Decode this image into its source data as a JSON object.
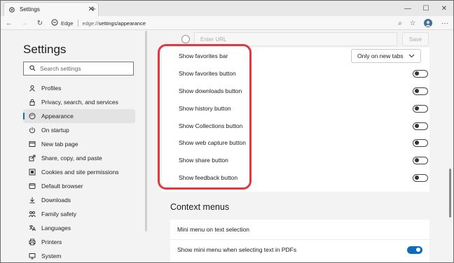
{
  "browser": {
    "tab_title": "Settings",
    "new_tab_symbol": "+",
    "site_label": "Edge",
    "url_prefix": "edge://",
    "url_path": "settings/appearance"
  },
  "sidebar": {
    "title": "Settings",
    "search_placeholder": "Search settings",
    "items": [
      {
        "label": "Profiles",
        "icon": "profile-icon"
      },
      {
        "label": "Privacy, search, and services",
        "icon": "lock-icon"
      },
      {
        "label": "Appearance",
        "icon": "palette-icon",
        "active": true
      },
      {
        "label": "On startup",
        "icon": "power-icon"
      },
      {
        "label": "New tab page",
        "icon": "newtab-icon"
      },
      {
        "label": "Share, copy, and paste",
        "icon": "share-icon"
      },
      {
        "label": "Cookies and site permissions",
        "icon": "cookie-icon"
      },
      {
        "label": "Default browser",
        "icon": "browser-icon"
      },
      {
        "label": "Downloads",
        "icon": "download-icon"
      },
      {
        "label": "Family safety",
        "icon": "family-icon"
      },
      {
        "label": "Languages",
        "icon": "language-icon"
      },
      {
        "label": "Printers",
        "icon": "printer-icon"
      },
      {
        "label": "System",
        "icon": "system-icon"
      }
    ]
  },
  "main": {
    "url_placeholder": "Enter URL",
    "save_label": "Save",
    "toolbar_settings": {
      "dropdown_value": "Only on new tabs",
      "rows": [
        {
          "label": "Show favorites bar"
        },
        {
          "label": "Show favorites button"
        },
        {
          "label": "Show downloads button"
        },
        {
          "label": "Show history button"
        },
        {
          "label": "Show Collections button"
        },
        {
          "label": "Show web capture button"
        },
        {
          "label": "Show share button"
        },
        {
          "label": "Show feedback button"
        }
      ]
    },
    "context_menus": {
      "title": "Context menus",
      "mini_menu_label": "Mini menu on text selection",
      "pdf_label": "Show mini menu when selecting text in PDFs",
      "pdf_enabled": true
    }
  },
  "colors": {
    "accent": "#0f6cbd",
    "highlight": "#e0393f"
  }
}
